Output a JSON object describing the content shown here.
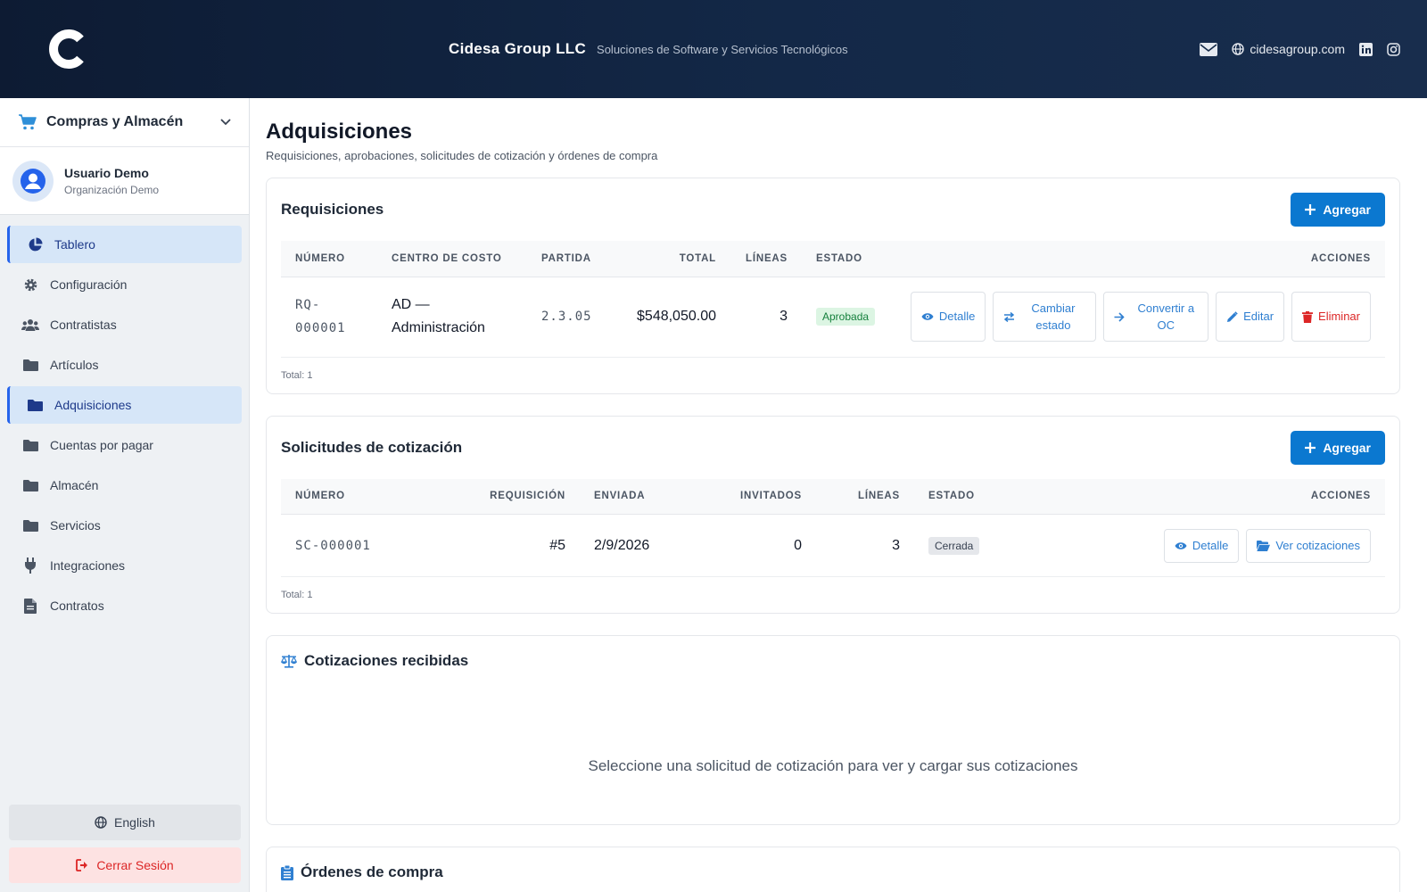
{
  "header": {
    "company": "Cidesa Group LLC",
    "tagline": "Soluciones de Software y Servicios Tecnológicos",
    "website": "cidesagroup.com"
  },
  "sidebar": {
    "module": "Compras y Almacén",
    "user": {
      "name": "Usuario Demo",
      "org": "Organización Demo"
    },
    "items": [
      {
        "label": "Tablero",
        "icon": "pie-chart-icon"
      },
      {
        "label": "Configuración",
        "icon": "gear-icon"
      },
      {
        "label": "Contratistas",
        "icon": "users-icon"
      },
      {
        "label": "Artículos",
        "icon": "folder-icon"
      },
      {
        "label": "Adquisiciones",
        "icon": "folder-icon"
      },
      {
        "label": "Cuentas por pagar",
        "icon": "folder-icon"
      },
      {
        "label": "Almacén",
        "icon": "folder-icon"
      },
      {
        "label": "Servicios",
        "icon": "folder-icon"
      },
      {
        "label": "Integraciones",
        "icon": "plug-icon"
      },
      {
        "label": "Contratos",
        "icon": "document-icon"
      }
    ],
    "language": "English",
    "logout": "Cerrar Sesión"
  },
  "page": {
    "title": "Adquisiciones",
    "subtitle": "Requisiciones, aprobaciones, solicitudes de cotización y órdenes de compra"
  },
  "requisiciones": {
    "title": "Requisiciones",
    "add": "Agregar",
    "headers": {
      "numero": "NÚMERO",
      "centro": "CENTRO DE COSTO",
      "partida": "PARTIDA",
      "total": "TOTAL",
      "lineas": "LÍNEAS",
      "estado": "ESTADO",
      "acciones": "ACCIONES"
    },
    "rows": [
      {
        "numero_1": "RQ-",
        "numero_2": "000001",
        "centro_1": "AD —",
        "centro_2": "Administración",
        "partida": "2.3.05",
        "total": "$548,050.00",
        "lineas": "3",
        "estado": "Aprobada"
      }
    ],
    "actions": {
      "detalle": "Detalle",
      "cambiar_1": "Cambiar",
      "cambiar_2": "estado",
      "convertir_1": "Convertir a",
      "convertir_2": "OC",
      "editar": "Editar",
      "eliminar": "Eliminar"
    },
    "total": "Total: 1"
  },
  "solicitudes": {
    "title": "Solicitudes de cotización",
    "add": "Agregar",
    "headers": {
      "numero": "NÚMERO",
      "requisicion": "REQUISICIÓN",
      "enviada": "ENVIADA",
      "invitados": "INVITADOS",
      "lineas": "LÍNEAS",
      "estado": "ESTADO",
      "acciones": "ACCIONES"
    },
    "rows": [
      {
        "numero": "SC-000001",
        "requisicion": "#5",
        "enviada": "2/9/2026",
        "invitados": "0",
        "lineas": "3",
        "estado": "Cerrada"
      }
    ],
    "actions": {
      "detalle": "Detalle",
      "ver": "Ver cotizaciones"
    },
    "total": "Total: 1"
  },
  "cotizaciones": {
    "title": "Cotizaciones recibidas",
    "empty": "Seleccione una solicitud de cotización para ver y cargar sus cotizaciones"
  },
  "ordenes": {
    "title": "Órdenes de compra"
  }
}
